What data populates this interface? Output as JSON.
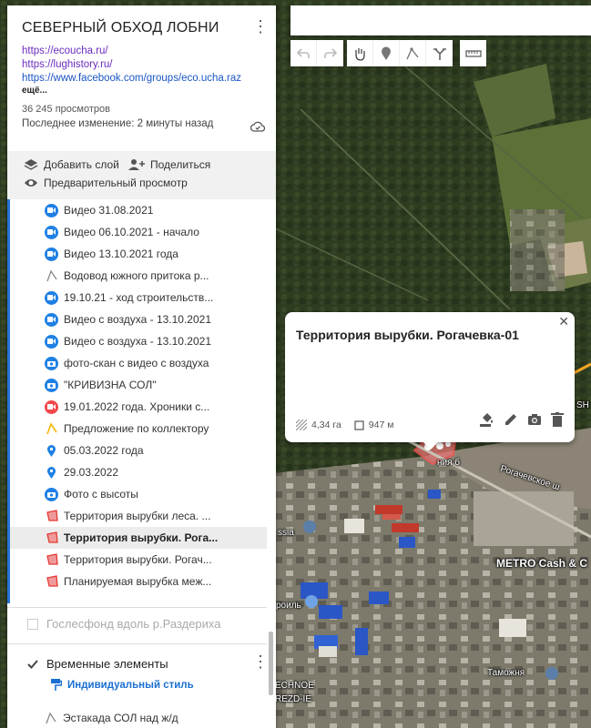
{
  "map": {
    "labels": {
      "street": "Рогачевское ш",
      "street_short": "ния б",
      "metro": "METRO Cash & C",
      "customs": "Таможня",
      "technoe": "ECHNOE",
      "rezd": "REZD-IE",
      "ssia": "ssia",
      "ril": "роиль",
      "sh": "SH"
    }
  },
  "panel": {
    "title": "СЕВЕРНЫЙ ОБХОД ЛОБНИ",
    "links": [
      "https://ecoucha.ru/",
      "https://lughistory.ru/",
      "https://www.facebook.com/groups/eco.ucha.raz"
    ],
    "more": "ещё...",
    "views": "36 245 просмотров",
    "last_modified": "Последнее изменение: 2 минуты назад",
    "add_layer": "Добавить слой",
    "share": "Поделиться",
    "preview": "Предварительный просмотр",
    "items": [
      {
        "label": "Видео 31.08.2021",
        "icon": "video-icon"
      },
      {
        "label": "Видео 06.10.2021 - начало",
        "icon": "video-icon"
      },
      {
        "label": "Видео 13.10.2021 года",
        "icon": "video-icon"
      },
      {
        "label": "Водовод южного притока р...",
        "icon": "line-icon"
      },
      {
        "label": "19.10.21 - ход строительств...",
        "icon": "video-icon"
      },
      {
        "label": "Видео с воздуха - 13.10.2021",
        "icon": "video-icon"
      },
      {
        "label": "Видео с воздуха - 13.10.2021",
        "icon": "video-icon"
      },
      {
        "label": "фото-скан с видео с воздуха",
        "icon": "camera-icon"
      },
      {
        "label": "\"КРИВИЗНА СОЛ\"",
        "icon": "camera-icon"
      },
      {
        "label": "19.01.2022 года. Хроники с...",
        "icon": "video-red-icon"
      },
      {
        "label": "Предложение по коллектору",
        "icon": "line-yellow-icon"
      },
      {
        "label": "05.03.2022 года",
        "icon": "pin-icon"
      },
      {
        "label": "29.03.2022",
        "icon": "pin-icon"
      },
      {
        "label": "Фото с высоты",
        "icon": "camera-icon"
      },
      {
        "label": "Территория вырубки леса. ...",
        "icon": "polygon-icon"
      },
      {
        "label": "Территория вырубки. Рога...",
        "icon": "polygon-icon"
      },
      {
        "label": "Территория вырубки. Рогач...",
        "icon": "polygon-icon"
      },
      {
        "label": "Планируемая вырубка меж...",
        "icon": "polygon-icon"
      }
    ],
    "selected_index": 15,
    "layer_goslesfond": "Гослесфонд вдоль р.Раздериха",
    "layer_temp": "Временные элементы",
    "style_link": "Индивидуальный стиль",
    "last_item": "Эстакада СОЛ над ж/д"
  },
  "popup": {
    "title": "Территория вырубки. Рогачевка-01",
    "area": "4,34 га",
    "perimeter": "947 м"
  },
  "colors": {
    "accent": "#1e80e4",
    "red_icon": "#f2474a",
    "polygon_red": "#e53935",
    "link_purple": "#6a2bbf"
  }
}
